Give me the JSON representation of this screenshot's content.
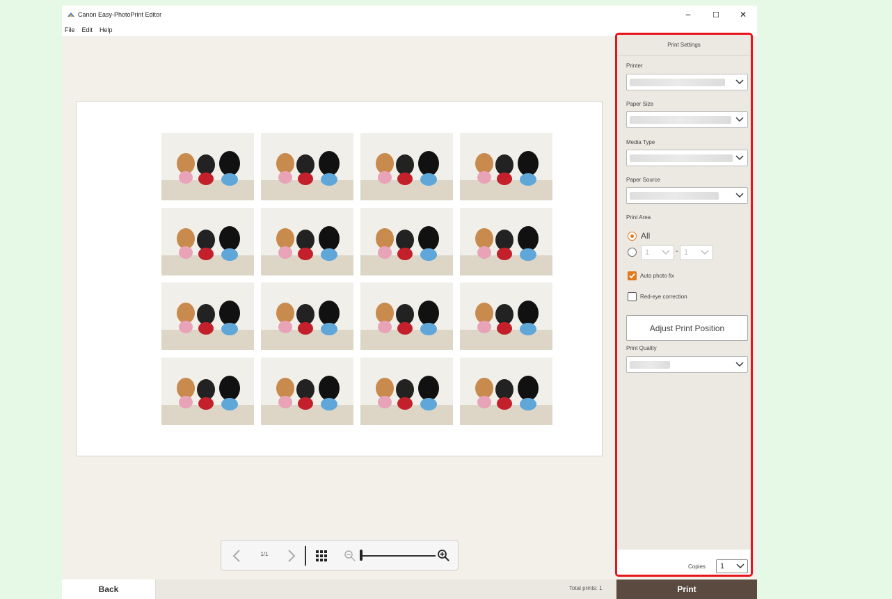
{
  "window": {
    "title": "Canon Easy-PhotoPrint Editor",
    "minimize": "−",
    "maximize": "☐",
    "close": "✕"
  },
  "menu": [
    "File",
    "Edit",
    "Help"
  ],
  "canvas": {
    "rows": 4,
    "cols": 4,
    "photo_count": 16
  },
  "toolbar": {
    "prev_icon": "chevron-left-icon",
    "page": "1/1",
    "next_icon": "chevron-right-icon",
    "grid_icon": "grid-icon",
    "zoom_out_icon": "zoom-out-icon",
    "zoom_in_icon": "zoom-in-icon",
    "zoom_level": 0.0
  },
  "bottom": {
    "back_label": "Back",
    "total_prints": "Total prints: 1",
    "print_label": "Print"
  },
  "settings": {
    "title": "Print Settings",
    "printer_label": "Printer",
    "paper_size_label": "Paper Size",
    "media_type_label": "Media Type",
    "paper_source_label": "Paper Source",
    "print_area_label": "Print Area",
    "area_all_label": "All",
    "area_from": "1",
    "area_dash": "-",
    "area_to": "1",
    "auto_photo_fix_label": "Auto photo fix",
    "auto_photo_fix_checked": true,
    "red_eye_label": "Red-eye correction",
    "red_eye_checked": false,
    "adjust_label": "Adjust Print Position",
    "print_quality_label": "Print Quality",
    "copies_label": "Copies",
    "copies_value": "1"
  },
  "colors": {
    "highlight_border": "#e8141c",
    "accent": "#e07a1d",
    "print_button": "#5a4a40"
  }
}
